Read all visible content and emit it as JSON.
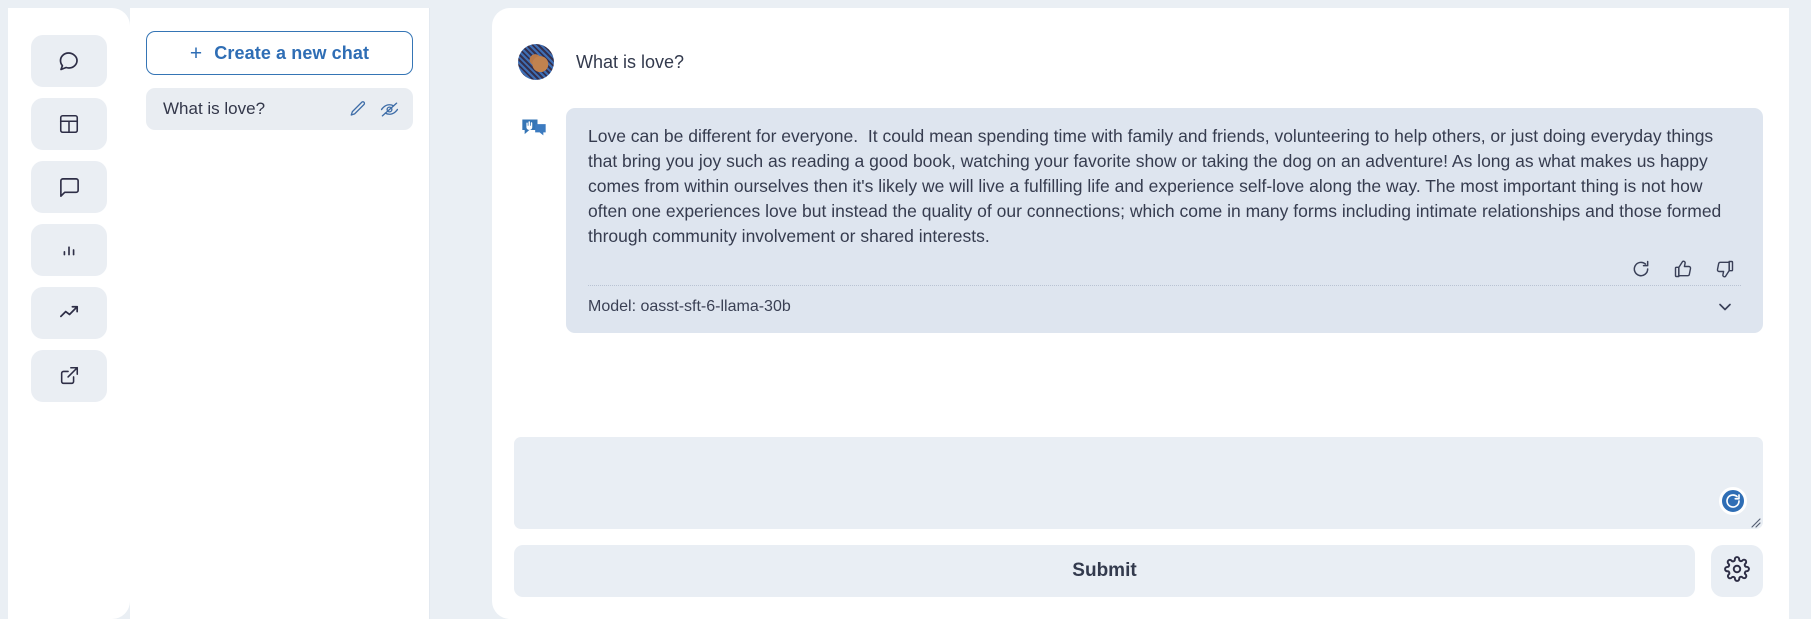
{
  "colors": {
    "page_bg": "#eaeff4",
    "panel_bg": "#ffffff",
    "accent_blue": "#2f6eb5",
    "bubble_bg": "#dee5ef",
    "control_bg": "#e9eef4",
    "text": "#333a4d"
  },
  "rail": {
    "items": [
      {
        "icon": "chat-round-icon",
        "name": "rail-item-chat"
      },
      {
        "icon": "dashboard-icon",
        "name": "rail-item-dashboard"
      },
      {
        "icon": "message-square-icon",
        "name": "rail-item-messages"
      },
      {
        "icon": "bar-chart-icon",
        "name": "rail-item-stats"
      },
      {
        "icon": "trending-up-icon",
        "name": "rail-item-trends"
      },
      {
        "icon": "external-link-icon",
        "name": "rail-item-external"
      }
    ]
  },
  "chat_list": {
    "new_chat_label": "Create a new chat",
    "new_chat_plus": "+",
    "items": [
      {
        "title": "What is love?",
        "edit_icon": "pencil-icon",
        "hide_icon": "eye-off-icon"
      }
    ]
  },
  "conversation": {
    "user": {
      "avatar": "globe-avatar",
      "text": "What is love?"
    },
    "assistant": {
      "icon": "assistant-wave-icon",
      "text": "Love can be different for everyone.  It could mean spending time with family and friends, volunteering to help others, or just doing everyday things that bring you joy such as reading a good book, watching your favorite show or taking the dog on an adventure! As long as what makes us happy comes from within ourselves then it's likely we will live a fulfilling life and experience self-love along the way. The most important thing is not how often one experiences love but instead the quality of our connections; which come in many forms including intimate relationships and those formed through community involvement or shared interests.",
      "actions": [
        {
          "icon": "retry-icon",
          "name": "retry-button"
        },
        {
          "icon": "thumbs-up-icon",
          "name": "thumbs-up-button"
        },
        {
          "icon": "thumbs-down-icon",
          "name": "thumbs-down-button"
        }
      ],
      "model_label": "Model: oasst-sft-6-llama-30b",
      "expand_icon": "chevron-down-icon"
    }
  },
  "composer": {
    "value": "",
    "placeholder": "",
    "send_icon": "regenerate-icon",
    "resize_handle": "resize-grip"
  },
  "footer": {
    "submit_label": "Submit",
    "settings_icon": "gear-icon"
  }
}
